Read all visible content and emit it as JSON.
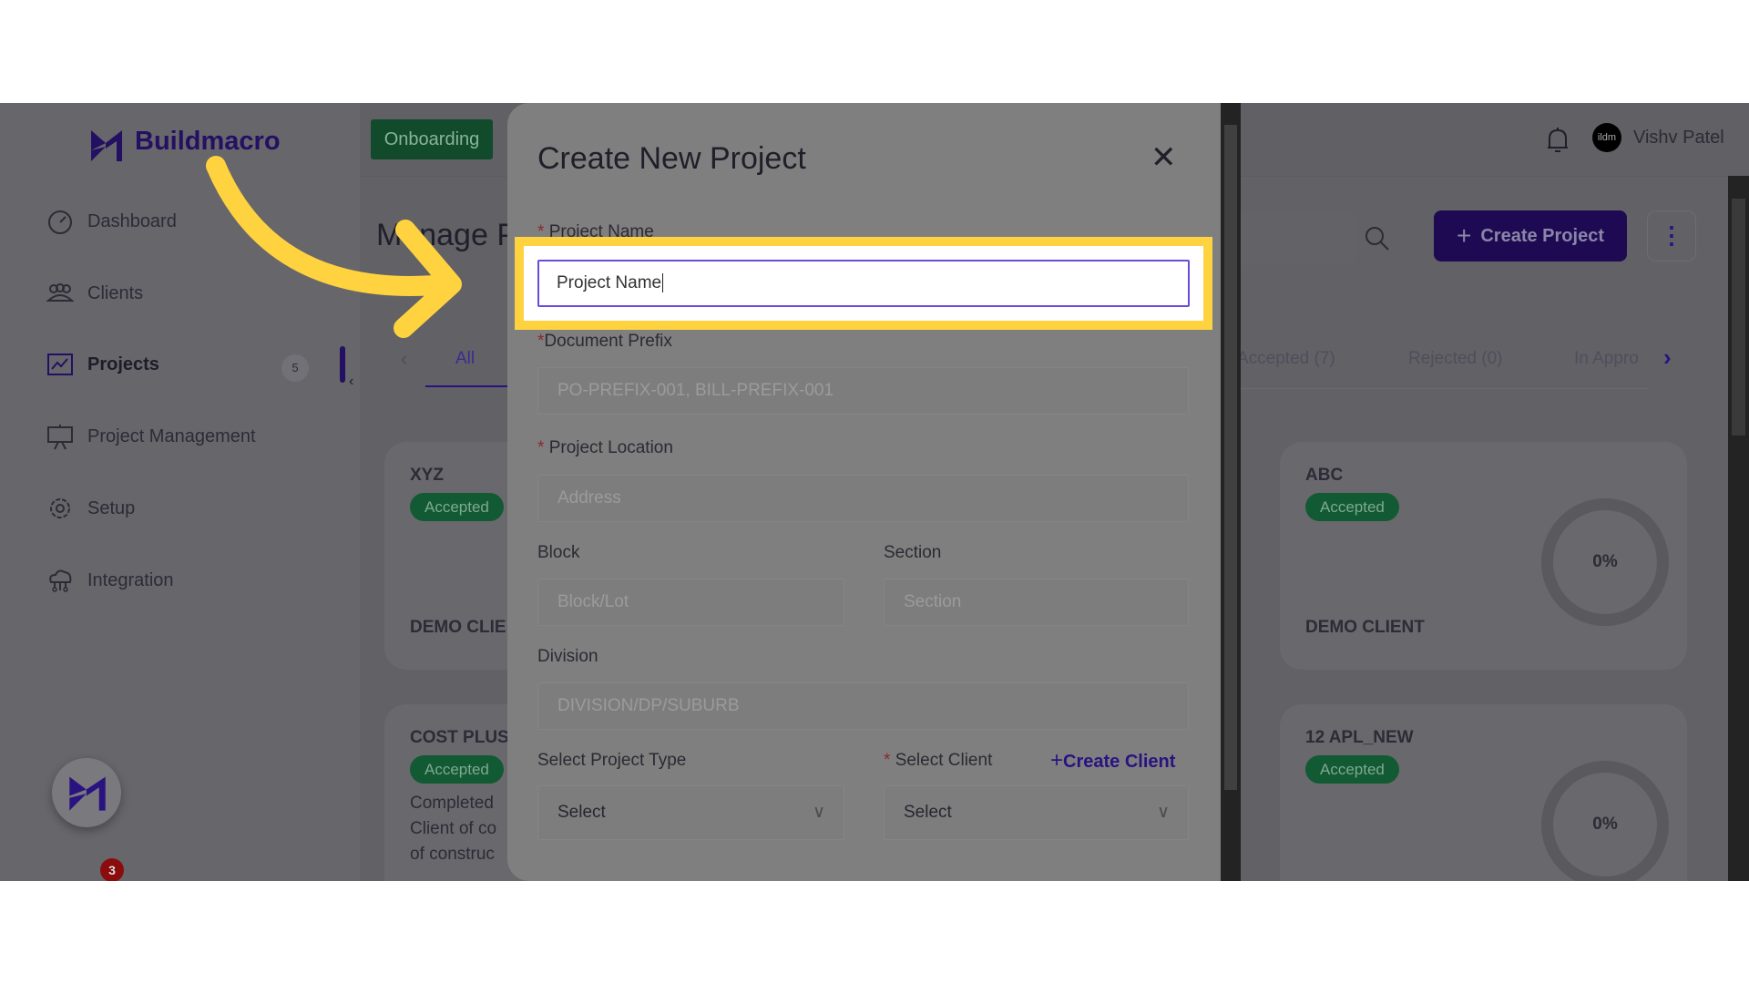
{
  "brand": {
    "name": "Buildmacro",
    "primary": "#241063",
    "accent_highlight": "#ffd23f",
    "success": "#125a33"
  },
  "header": {
    "onboarding_label": "Onboarding",
    "user_name": "Vishv Patel",
    "avatar_text": "ildm"
  },
  "sidebar": {
    "items": [
      {
        "label": "Dashboard",
        "icon": "speedometer-icon"
      },
      {
        "label": "Clients",
        "icon": "users-icon"
      },
      {
        "label": "Projects",
        "icon": "chart-line-icon",
        "badge": "5",
        "active": true
      },
      {
        "label": "Project Management",
        "icon": "presentation-board-icon"
      },
      {
        "label": "Setup",
        "icon": "gear-icon"
      },
      {
        "label": "Integration",
        "icon": "cloud-network-icon"
      }
    ],
    "chat_badge": "3"
  },
  "main": {
    "title": "Manage P",
    "create_button": "Create Project",
    "tabs": [
      "All",
      "Accepted (7)",
      "Rejected (0)",
      "In Appro"
    ],
    "cards": [
      {
        "title": "XYZ",
        "status": "Accepted",
        "client": "DEMO CLIE"
      },
      {
        "title": "COST PLUS",
        "status": "Accepted",
        "desc": [
          "Completed",
          "Client of co",
          "of construc"
        ]
      },
      {
        "title": "ABC",
        "status": "Accepted",
        "client": "DEMO CLIENT",
        "progress": "0%"
      },
      {
        "title": "12 APL_NEW",
        "status": "Accepted",
        "progress": "0%"
      }
    ]
  },
  "modal": {
    "title": "Create New Project",
    "project_name": {
      "label": "Project Name",
      "value": "Project Name"
    },
    "document_prefix": {
      "label": "Document Prefix",
      "placeholder": "PO-PREFIX-001, BILL-PREFIX-001"
    },
    "location": {
      "label": "Project Location",
      "placeholder": "Address"
    },
    "block": {
      "label": "Block",
      "placeholder": "Block/Lot"
    },
    "section": {
      "label": "Section",
      "placeholder": "Section"
    },
    "division": {
      "label": "Division",
      "placeholder": "DIVISION/DP/SUBURB"
    },
    "project_type": {
      "label": "Select Project Type",
      "value": "Select"
    },
    "client": {
      "label": "Select Client",
      "value": "Select",
      "create_link": "Create Client"
    },
    "required_mark": "*"
  }
}
